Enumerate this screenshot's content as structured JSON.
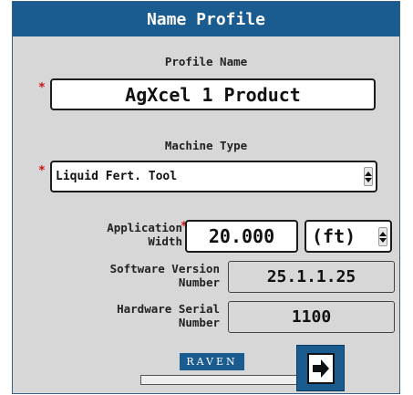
{
  "dialog": {
    "title": "Name Profile",
    "profile_name": {
      "label": "Profile Name",
      "value": "AgXcel 1 Product",
      "required_mark": "*"
    },
    "machine_type": {
      "label": "Machine Type",
      "value": "Liquid Fert. Tool",
      "required_mark": "*"
    },
    "application_width": {
      "label_line1": "Application",
      "label_line2": "Width",
      "required_mark": "*",
      "value": "20.000",
      "unit": "(ft)"
    },
    "software_version": {
      "label_line1": "Software Version",
      "label_line2": "Number",
      "value": "25.1.1.25"
    },
    "hardware_serial": {
      "label_line1": "Hardware Serial",
      "label_line2": "Number",
      "value": "1100"
    },
    "logo_text": "RAVEN",
    "progress": 0,
    "next_button_icon": "next-page-icon"
  },
  "colors": {
    "title_bar": "#1a5c90",
    "panel": "#d7d7d7",
    "required": "#d01010",
    "accent": "#1a5c90"
  }
}
